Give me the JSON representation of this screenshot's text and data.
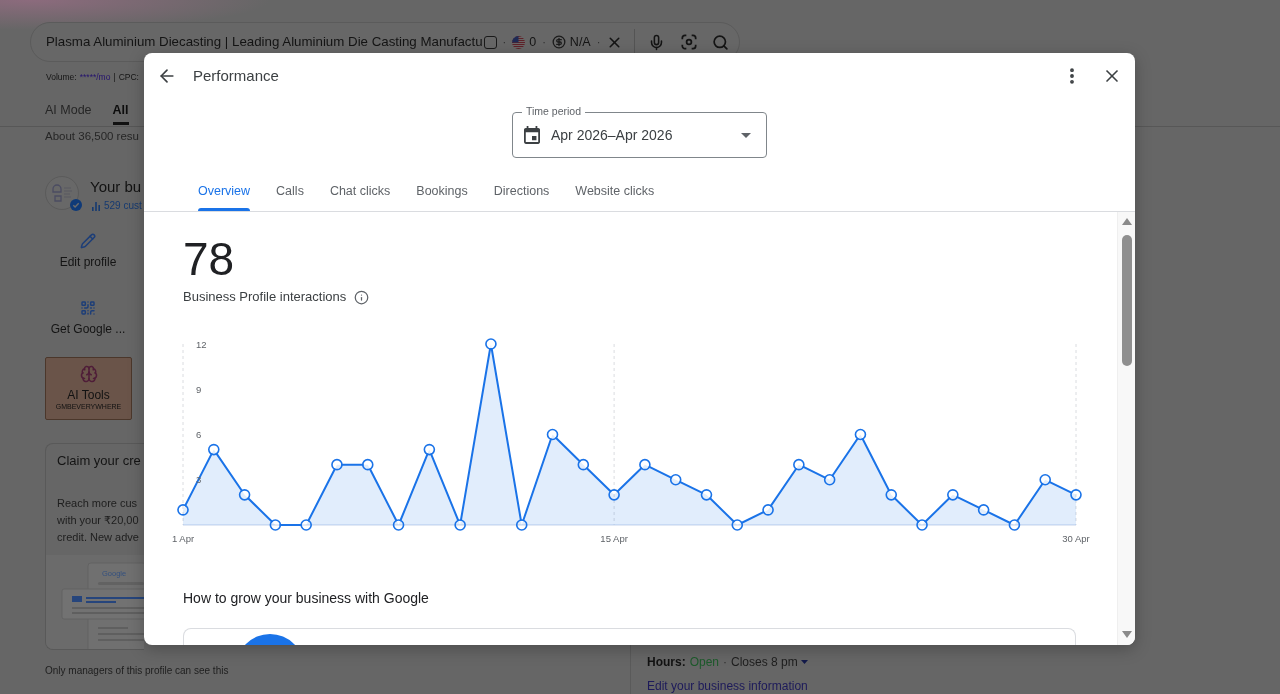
{
  "search_bar": {
    "query": "Plasma Aluminium Diecasting | Leading Aluminium Die Casting Manufactu",
    "extras": [
      {
        "kind": "checkbox",
        "checked": false
      },
      {
        "kind": "separator",
        "text": "·"
      },
      {
        "kind": "flag",
        "text": "0"
      },
      {
        "kind": "separator",
        "text": "·"
      },
      {
        "kind": "coin",
        "text": "N/A"
      },
      {
        "kind": "separator",
        "text": "·"
      }
    ]
  },
  "seo_bar": {
    "volume_label": "Volume:",
    "volume_value": "*****/mo",
    "separator": "|",
    "cpc_label": "CPC:"
  },
  "search_tabs": [
    {
      "label": "AI Mode",
      "selected": false
    },
    {
      "label": "All",
      "selected": true
    }
  ],
  "results_count": "About 36,500 resu",
  "business_profile": {
    "title": "Your bu",
    "verified": true,
    "stats": "529 cust",
    "actions": [
      {
        "kind": "edit",
        "label": "Edit profile"
      },
      {
        "kind": "qr",
        "label": "Get Google ..."
      }
    ],
    "ai_tools": {
      "title": "AI Tools",
      "subtitle": "GMBEVERYWHERE"
    },
    "promo_card": {
      "title": "Claim your cre",
      "lines": [
        "Reach more cus",
        "with your ₹20,00",
        "credit. New adve"
      ],
      "illustration_logo": "Google"
    },
    "footnote": "Only managers of this profile can see this"
  },
  "business_info": {
    "hours_label": "Hours:",
    "status": "Open",
    "separator": "·",
    "closing": "Closes 8 pm",
    "edit_link": "Edit your business information"
  },
  "dialog": {
    "title": "Performance",
    "time_period": {
      "label": "Time period",
      "value": "Apr 2026–Apr 2026"
    },
    "tabs": [
      {
        "label": "Overview",
        "selected": true
      },
      {
        "label": "Calls",
        "selected": false
      },
      {
        "label": "Chat clicks",
        "selected": false
      },
      {
        "label": "Bookings",
        "selected": false
      },
      {
        "label": "Directions",
        "selected": false
      },
      {
        "label": "Website clicks",
        "selected": false
      }
    ],
    "metric": {
      "value": "78",
      "label": "Business Profile interactions"
    },
    "chart_data": {
      "type": "area",
      "categories": [
        "1 Apr",
        null,
        null,
        null,
        null,
        null,
        null,
        null,
        null,
        null,
        null,
        null,
        null,
        null,
        "15 Apr",
        null,
        null,
        null,
        null,
        null,
        null,
        null,
        null,
        null,
        null,
        null,
        null,
        null,
        null,
        "30 Apr"
      ],
      "series": [
        {
          "color": "#1a73e8",
          "values": [
            1,
            5,
            2,
            0,
            0,
            4,
            4,
            0,
            5,
            0,
            12,
            0,
            6,
            4,
            2,
            4,
            3,
            2,
            0,
            1,
            4,
            3,
            6,
            2,
            0,
            2,
            1,
            0,
            3,
            2
          ]
        }
      ],
      "ylim": [
        0,
        12
      ],
      "yticks": [
        3,
        6,
        9,
        12
      ]
    },
    "section_title": "How to grow your business with Google"
  }
}
